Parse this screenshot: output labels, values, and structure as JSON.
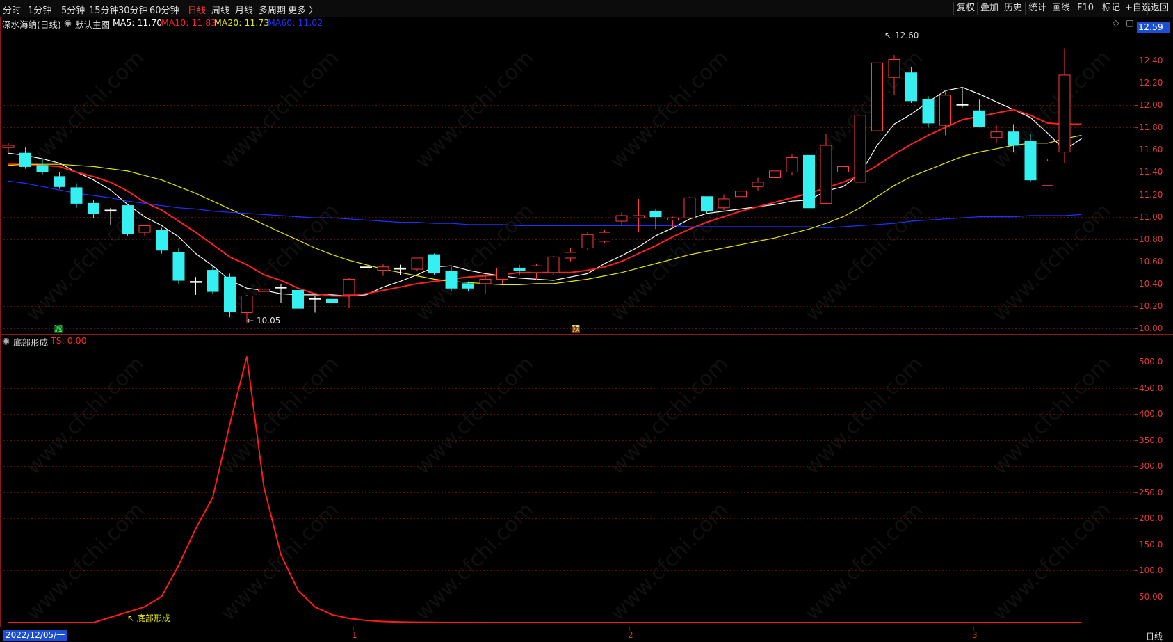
{
  "toolbar": {
    "periods": [
      "分时",
      "1分钟",
      "5分钟",
      "15分钟",
      "30分钟",
      "60分钟",
      "日线",
      "周线",
      "月线",
      "多周期",
      "更多 〉"
    ],
    "active_period": "日线",
    "right_buttons": [
      "复权",
      "叠加",
      "历史",
      "统计",
      "画线",
      "F10",
      "标记",
      "+自选",
      "返回"
    ]
  },
  "main_panel": {
    "stock_name": "深水海纳(日线)",
    "chart_name": "默认主图",
    "ma": [
      {
        "label": "MA5: 11.70",
        "color": "#ffffff"
      },
      {
        "label": "MA10: 11.83",
        "color": "#ff2020"
      },
      {
        "label": "MA20: 11.73",
        "color": "#e8e800"
      },
      {
        "label": "MA60: 11.02",
        "color": "#2030ff"
      }
    ],
    "price_badge": "12.59",
    "high_label": "12.60",
    "low_label": "10.05",
    "marker_jian": "减",
    "marker_yu": "预",
    "y_ticks": [
      "12.40",
      "12.20",
      "12.00",
      "11.80",
      "11.60",
      "11.40",
      "11.20",
      "11.00",
      "10.80",
      "10.60",
      "10.40",
      "10.20",
      "10.00"
    ]
  },
  "sub_panel": {
    "indicator_name": "底部形成",
    "ts_label": "TS: 0.00",
    "annotation": "底部形成",
    "y_ticks": [
      "500.0",
      "450.0",
      "400.0",
      "350.0",
      "300.0",
      "250.0",
      "200.0",
      "150.0",
      "100.0",
      "50.00"
    ]
  },
  "bottom_bar": {
    "date_label": "2022/12/05/一",
    "month_marks": [
      "1",
      "2",
      "3"
    ],
    "period_label": "日线"
  },
  "watermark": "www.cfchi.com",
  "chart_data": [
    {
      "type": "candlestick",
      "title": "深水海纳(日线)",
      "ylim": [
        10.0,
        12.6
      ],
      "candles": [
        [
          11.62,
          11.66,
          11.58,
          11.64
        ],
        [
          11.57,
          11.62,
          11.43,
          11.45
        ],
        [
          11.46,
          11.52,
          11.38,
          11.4
        ],
        [
          11.36,
          11.4,
          11.25,
          11.27
        ],
        [
          11.26,
          11.3,
          11.08,
          11.12
        ],
        [
          11.12,
          11.15,
          10.99,
          11.03
        ],
        [
          11.05,
          11.08,
          10.93,
          11.06
        ],
        [
          11.1,
          11.1,
          10.83,
          10.85
        ],
        [
          10.86,
          10.92,
          10.83,
          10.92
        ],
        [
          10.88,
          10.9,
          10.67,
          10.7
        ],
        [
          10.68,
          10.72,
          10.4,
          10.43
        ],
        [
          10.42,
          10.46,
          10.3,
          10.42
        ],
        [
          10.52,
          10.56,
          10.31,
          10.33
        ],
        [
          10.46,
          10.49,
          10.1,
          10.15
        ],
        [
          10.14,
          10.3,
          10.05,
          10.29
        ],
        [
          10.33,
          10.37,
          10.22,
          10.35
        ],
        [
          10.37,
          10.4,
          10.23,
          10.37
        ],
        [
          10.34,
          10.36,
          10.19,
          10.18
        ],
        [
          10.27,
          10.29,
          10.14,
          10.27
        ],
        [
          10.26,
          10.27,
          10.18,
          10.23
        ],
        [
          10.3,
          10.45,
          10.18,
          10.44
        ],
        [
          10.54,
          10.64,
          10.45,
          10.55
        ],
        [
          10.52,
          10.58,
          10.47,
          10.55
        ],
        [
          10.54,
          10.57,
          10.48,
          10.53
        ],
        [
          10.53,
          10.63,
          10.51,
          10.63
        ],
        [
          10.66,
          10.67,
          10.48,
          10.5
        ],
        [
          10.51,
          10.55,
          10.33,
          10.36
        ],
        [
          10.4,
          10.42,
          10.33,
          10.36
        ],
        [
          10.4,
          10.49,
          10.31,
          10.44
        ],
        [
          10.44,
          10.54,
          10.4,
          10.54
        ],
        [
          10.54,
          10.57,
          10.48,
          10.52
        ],
        [
          10.5,
          10.58,
          10.43,
          10.56
        ],
        [
          10.5,
          10.65,
          10.48,
          10.64
        ],
        [
          10.63,
          10.72,
          10.6,
          10.68
        ],
        [
          10.72,
          10.86,
          10.7,
          10.84
        ],
        [
          10.78,
          10.88,
          10.76,
          10.86
        ],
        [
          10.96,
          11.04,
          10.92,
          11.01
        ],
        [
          10.99,
          11.16,
          10.86,
          11.01
        ],
        [
          11.05,
          11.07,
          10.89,
          11.0
        ],
        [
          10.97,
          11.0,
          10.9,
          10.99
        ],
        [
          10.99,
          11.18,
          10.97,
          11.17
        ],
        [
          11.18,
          11.18,
          11.03,
          11.05
        ],
        [
          11.08,
          11.2,
          11.06,
          11.16
        ],
        [
          11.18,
          11.26,
          11.17,
          11.23
        ],
        [
          11.27,
          11.35,
          11.23,
          11.31
        ],
        [
          11.35,
          11.45,
          11.27,
          11.41
        ],
        [
          11.4,
          11.56,
          11.37,
          11.53
        ],
        [
          11.55,
          11.56,
          11.0,
          11.08
        ],
        [
          11.12,
          11.74,
          11.11,
          11.64
        ],
        [
          11.4,
          11.47,
          11.25,
          11.45
        ],
        [
          11.31,
          11.91,
          11.31,
          11.91
        ],
        [
          11.77,
          12.6,
          11.73,
          12.38
        ],
        [
          12.25,
          12.45,
          12.09,
          12.41
        ],
        [
          12.29,
          12.34,
          12.02,
          12.04
        ],
        [
          12.05,
          12.08,
          11.8,
          11.84
        ],
        [
          11.82,
          12.13,
          11.73,
          12.09
        ],
        [
          12.0,
          12.16,
          11.98,
          12.01
        ],
        [
          11.95,
          12.05,
          11.8,
          11.81
        ],
        [
          11.71,
          11.82,
          11.66,
          11.76
        ],
        [
          11.76,
          11.83,
          11.58,
          11.64
        ],
        [
          11.68,
          11.74,
          11.31,
          11.33
        ],
        [
          11.28,
          11.52,
          11.28,
          11.5
        ],
        [
          11.58,
          12.51,
          11.48,
          12.27
        ]
      ],
      "series": [
        {
          "name": "MA5",
          "color": "#ffffff",
          "values": [
            11.57,
            11.55,
            11.52,
            11.48,
            11.4,
            11.33,
            11.24,
            11.11,
            11.0,
            10.92,
            10.82,
            10.67,
            10.56,
            10.43,
            10.36,
            10.34,
            10.31,
            10.3,
            10.3,
            10.3,
            10.29,
            10.3,
            10.37,
            10.42,
            10.48,
            10.55,
            10.56,
            10.52,
            10.49,
            10.47,
            10.45,
            10.44,
            10.43,
            10.46,
            10.49,
            10.58,
            10.65,
            10.73,
            10.83,
            10.9,
            10.98,
            11.03,
            11.05,
            11.07,
            11.09,
            11.11,
            11.14,
            11.15,
            11.23,
            11.27,
            11.38,
            11.64,
            11.83,
            11.92,
            12.03,
            12.13,
            12.16,
            12.1,
            12.03,
            11.96,
            11.89,
            11.75,
            11.6,
            11.7
          ]
        },
        {
          "name": "MA10",
          "color": "#ff2020",
          "values": [
            11.47,
            11.47,
            11.46,
            11.45,
            11.4,
            11.36,
            11.31,
            11.23,
            11.13,
            11.06,
            10.96,
            10.86,
            10.75,
            10.64,
            10.57,
            10.48,
            10.43,
            10.36,
            10.31,
            10.29,
            10.29,
            10.31,
            10.34,
            10.37,
            10.4,
            10.42,
            10.44,
            10.46,
            10.47,
            10.48,
            10.5,
            10.5,
            10.5,
            10.5,
            10.52,
            10.55,
            10.6,
            10.67,
            10.74,
            10.82,
            10.89,
            10.95,
            11.0,
            11.05,
            11.09,
            11.13,
            11.17,
            11.21,
            11.26,
            11.31,
            11.37,
            11.46,
            11.56,
            11.65,
            11.73,
            11.8,
            11.87,
            11.9,
            11.93,
            11.96,
            11.91,
            11.84,
            11.83,
            11.83
          ]
        },
        {
          "name": "MA20",
          "color": "#e8e800",
          "values": [
            11.46,
            11.47,
            11.47,
            11.47,
            11.46,
            11.45,
            11.43,
            11.41,
            11.37,
            11.33,
            11.27,
            11.21,
            11.14,
            11.07,
            11.0,
            10.93,
            10.86,
            10.79,
            10.72,
            10.66,
            10.61,
            10.57,
            10.53,
            10.5,
            10.47,
            10.44,
            10.42,
            10.41,
            10.4,
            10.39,
            10.39,
            10.4,
            10.4,
            10.42,
            10.44,
            10.47,
            10.5,
            10.54,
            10.58,
            10.62,
            10.66,
            10.69,
            10.72,
            10.75,
            10.78,
            10.81,
            10.85,
            10.89,
            10.94,
            11.0,
            11.08,
            11.18,
            11.28,
            11.36,
            11.42,
            11.48,
            11.54,
            11.58,
            11.61,
            11.64,
            11.66,
            11.66,
            11.7,
            11.73
          ]
        },
        {
          "name": "MA60",
          "color": "#2030ff",
          "values": [
            11.32,
            11.3,
            11.27,
            11.24,
            11.21,
            11.19,
            11.17,
            11.14,
            11.12,
            11.1,
            11.08,
            11.07,
            11.05,
            11.04,
            11.03,
            11.02,
            11.01,
            11.0,
            10.99,
            10.99,
            10.98,
            10.97,
            10.96,
            10.95,
            10.95,
            10.94,
            10.94,
            10.93,
            10.93,
            10.93,
            10.92,
            10.92,
            10.92,
            10.92,
            10.92,
            10.92,
            10.92,
            10.92,
            10.92,
            10.92,
            10.91,
            10.91,
            10.91,
            10.91,
            10.91,
            10.91,
            10.91,
            10.91,
            10.9,
            10.91,
            10.92,
            10.93,
            10.94,
            10.96,
            10.97,
            10.98,
            10.99,
            11.0,
            11.0,
            11.0,
            11.01,
            11.01,
            11.01,
            11.02
          ]
        }
      ]
    },
    {
      "type": "line",
      "title": "底部形成",
      "ylim": [
        0,
        520
      ],
      "series": [
        {
          "name": "TS",
          "color": "#ff1a1a",
          "values": [
            0,
            0,
            0,
            0,
            0,
            0,
            10,
            20,
            30,
            50,
            110,
            180,
            240,
            380,
            510,
            260,
            130,
            62,
            30,
            15,
            8,
            4,
            2,
            1,
            0.5,
            0.3,
            0.2,
            0.1,
            0,
            0,
            0,
            0,
            0,
            0,
            0,
            0,
            0,
            0,
            0,
            0,
            0,
            0,
            0,
            0,
            0,
            0,
            0,
            0,
            0,
            0,
            0,
            0,
            0,
            0,
            0,
            0,
            0,
            0,
            0,
            0,
            0,
            0,
            0,
            0
          ]
        }
      ]
    }
  ]
}
